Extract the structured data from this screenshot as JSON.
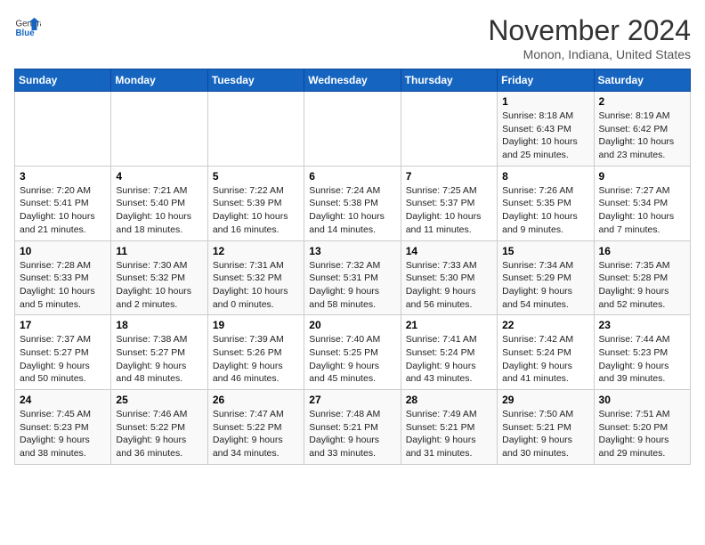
{
  "logo": {
    "general": "General",
    "blue": "Blue"
  },
  "title": "November 2024",
  "subtitle": "Monon, Indiana, United States",
  "headers": [
    "Sunday",
    "Monday",
    "Tuesday",
    "Wednesday",
    "Thursday",
    "Friday",
    "Saturday"
  ],
  "weeks": [
    [
      {
        "day": "",
        "info": ""
      },
      {
        "day": "",
        "info": ""
      },
      {
        "day": "",
        "info": ""
      },
      {
        "day": "",
        "info": ""
      },
      {
        "day": "",
        "info": ""
      },
      {
        "day": "1",
        "info": "Sunrise: 8:18 AM\nSunset: 6:43 PM\nDaylight: 10 hours and 25 minutes."
      },
      {
        "day": "2",
        "info": "Sunrise: 8:19 AM\nSunset: 6:42 PM\nDaylight: 10 hours and 23 minutes."
      }
    ],
    [
      {
        "day": "3",
        "info": "Sunrise: 7:20 AM\nSunset: 5:41 PM\nDaylight: 10 hours and 21 minutes."
      },
      {
        "day": "4",
        "info": "Sunrise: 7:21 AM\nSunset: 5:40 PM\nDaylight: 10 hours and 18 minutes."
      },
      {
        "day": "5",
        "info": "Sunrise: 7:22 AM\nSunset: 5:39 PM\nDaylight: 10 hours and 16 minutes."
      },
      {
        "day": "6",
        "info": "Sunrise: 7:24 AM\nSunset: 5:38 PM\nDaylight: 10 hours and 14 minutes."
      },
      {
        "day": "7",
        "info": "Sunrise: 7:25 AM\nSunset: 5:37 PM\nDaylight: 10 hours and 11 minutes."
      },
      {
        "day": "8",
        "info": "Sunrise: 7:26 AM\nSunset: 5:35 PM\nDaylight: 10 hours and 9 minutes."
      },
      {
        "day": "9",
        "info": "Sunrise: 7:27 AM\nSunset: 5:34 PM\nDaylight: 10 hours and 7 minutes."
      }
    ],
    [
      {
        "day": "10",
        "info": "Sunrise: 7:28 AM\nSunset: 5:33 PM\nDaylight: 10 hours and 5 minutes."
      },
      {
        "day": "11",
        "info": "Sunrise: 7:30 AM\nSunset: 5:32 PM\nDaylight: 10 hours and 2 minutes."
      },
      {
        "day": "12",
        "info": "Sunrise: 7:31 AM\nSunset: 5:32 PM\nDaylight: 10 hours and 0 minutes."
      },
      {
        "day": "13",
        "info": "Sunrise: 7:32 AM\nSunset: 5:31 PM\nDaylight: 9 hours and 58 minutes."
      },
      {
        "day": "14",
        "info": "Sunrise: 7:33 AM\nSunset: 5:30 PM\nDaylight: 9 hours and 56 minutes."
      },
      {
        "day": "15",
        "info": "Sunrise: 7:34 AM\nSunset: 5:29 PM\nDaylight: 9 hours and 54 minutes."
      },
      {
        "day": "16",
        "info": "Sunrise: 7:35 AM\nSunset: 5:28 PM\nDaylight: 9 hours and 52 minutes."
      }
    ],
    [
      {
        "day": "17",
        "info": "Sunrise: 7:37 AM\nSunset: 5:27 PM\nDaylight: 9 hours and 50 minutes."
      },
      {
        "day": "18",
        "info": "Sunrise: 7:38 AM\nSunset: 5:27 PM\nDaylight: 9 hours and 48 minutes."
      },
      {
        "day": "19",
        "info": "Sunrise: 7:39 AM\nSunset: 5:26 PM\nDaylight: 9 hours and 46 minutes."
      },
      {
        "day": "20",
        "info": "Sunrise: 7:40 AM\nSunset: 5:25 PM\nDaylight: 9 hours and 45 minutes."
      },
      {
        "day": "21",
        "info": "Sunrise: 7:41 AM\nSunset: 5:24 PM\nDaylight: 9 hours and 43 minutes."
      },
      {
        "day": "22",
        "info": "Sunrise: 7:42 AM\nSunset: 5:24 PM\nDaylight: 9 hours and 41 minutes."
      },
      {
        "day": "23",
        "info": "Sunrise: 7:44 AM\nSunset: 5:23 PM\nDaylight: 9 hours and 39 minutes."
      }
    ],
    [
      {
        "day": "24",
        "info": "Sunrise: 7:45 AM\nSunset: 5:23 PM\nDaylight: 9 hours and 38 minutes."
      },
      {
        "day": "25",
        "info": "Sunrise: 7:46 AM\nSunset: 5:22 PM\nDaylight: 9 hours and 36 minutes."
      },
      {
        "day": "26",
        "info": "Sunrise: 7:47 AM\nSunset: 5:22 PM\nDaylight: 9 hours and 34 minutes."
      },
      {
        "day": "27",
        "info": "Sunrise: 7:48 AM\nSunset: 5:21 PM\nDaylight: 9 hours and 33 minutes."
      },
      {
        "day": "28",
        "info": "Sunrise: 7:49 AM\nSunset: 5:21 PM\nDaylight: 9 hours and 31 minutes."
      },
      {
        "day": "29",
        "info": "Sunrise: 7:50 AM\nSunset: 5:21 PM\nDaylight: 9 hours and 30 minutes."
      },
      {
        "day": "30",
        "info": "Sunrise: 7:51 AM\nSunset: 5:20 PM\nDaylight: 9 hours and 29 minutes."
      }
    ]
  ]
}
